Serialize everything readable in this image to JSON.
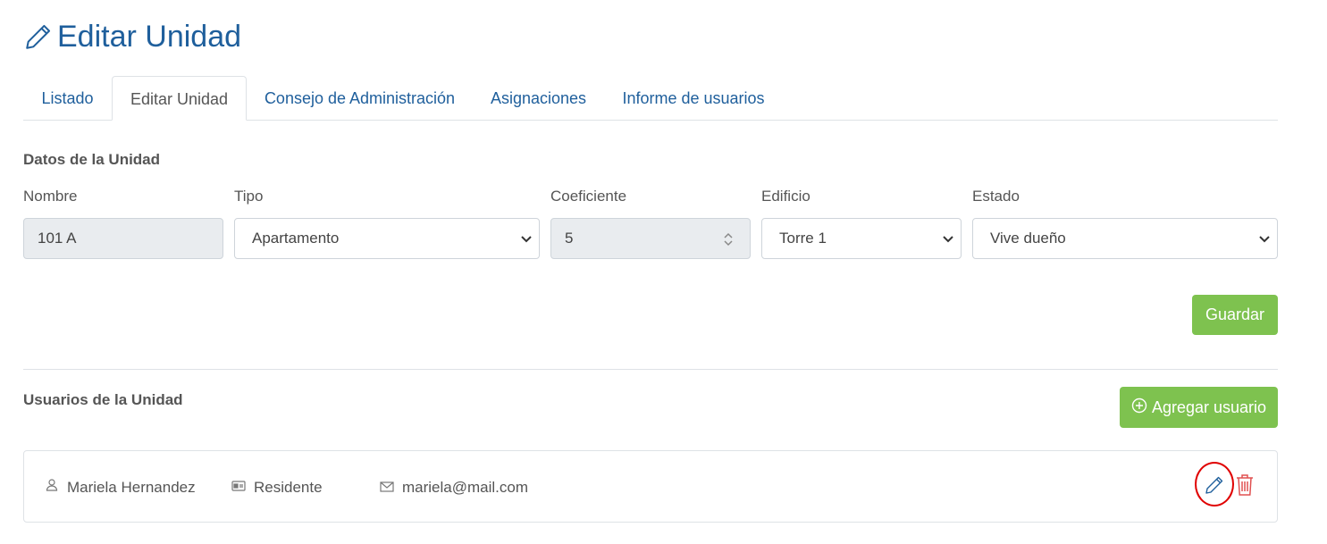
{
  "page": {
    "title": "Editar Unidad",
    "title_icon": "pencil-icon"
  },
  "tabs": [
    {
      "label": "Listado",
      "active": false
    },
    {
      "label": "Editar Unidad",
      "active": true
    },
    {
      "label": "Consejo de Administración",
      "active": false
    },
    {
      "label": "Asignaciones",
      "active": false
    },
    {
      "label": "Informe de usuarios",
      "active": false
    }
  ],
  "unit_data": {
    "section_title": "Datos de la Unidad",
    "fields": {
      "nombre": {
        "label": "Nombre",
        "value": "101 A",
        "disabled": true
      },
      "tipo": {
        "label": "Tipo",
        "value": "Apartamento",
        "control": "select"
      },
      "coeficiente": {
        "label": "Coeficiente",
        "value": "5",
        "control": "number",
        "disabled": true
      },
      "edificio": {
        "label": "Edificio",
        "value": "Torre 1",
        "control": "select"
      },
      "estado": {
        "label": "Estado",
        "value": "Vive dueño",
        "control": "select"
      }
    },
    "save_label": "Guardar"
  },
  "unit_users": {
    "section_title": "Usuarios de la Unidad",
    "add_label": "Agregar usuario",
    "add_icon": "plus-circle-icon",
    "users": [
      {
        "name": "Mariela Hernandez",
        "role": "Residente",
        "email": "mariela@mail.com",
        "name_icon": "user-icon",
        "role_icon": "id-card-icon",
        "email_icon": "envelope-icon",
        "edit_icon": "pencil-icon",
        "delete_icon": "trash-icon"
      }
    ]
  },
  "colors": {
    "brand_blue": "#1f5f9c",
    "button_green": "#7ec24f",
    "delete_red": "#e05050",
    "highlight_ring": "#e00000"
  }
}
